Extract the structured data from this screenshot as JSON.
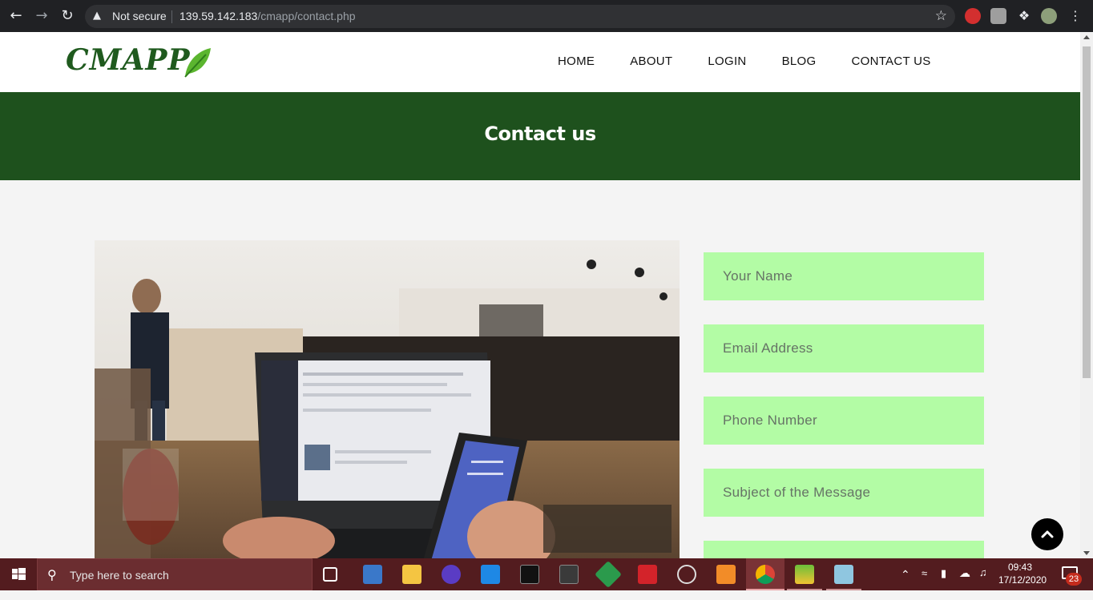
{
  "browser": {
    "security_label": "Not secure",
    "url_host": "139.59.142.183",
    "url_path": "/cmapp/contact.php"
  },
  "site": {
    "logo_text": "CMAPP",
    "nav": [
      "HOME",
      "ABOUT",
      "LOGIN",
      "BLOG",
      "CONTACT US"
    ],
    "banner_title": "Contact us",
    "brand_green": "#1e511d",
    "field_color": "#b3fca5"
  },
  "form": {
    "name_placeholder": "Your Name",
    "email_placeholder": "Email Address",
    "phone_placeholder": "Phone Number",
    "subject_placeholder": "Subject of the Message"
  },
  "taskbar": {
    "search_placeholder": "Type here to search",
    "time": "09:43",
    "date": "17/12/2020",
    "notification_count": "23"
  }
}
